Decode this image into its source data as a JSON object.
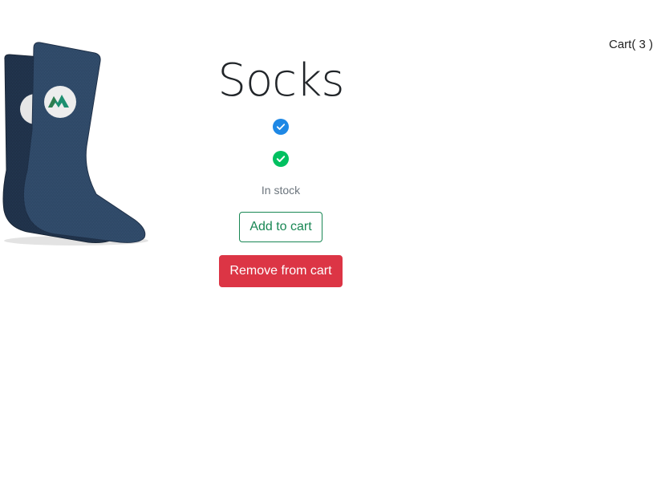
{
  "header": {
    "cart_label": "Cart( 3 )"
  },
  "product": {
    "title": "Socks",
    "image_icon": "socks-product-image",
    "verified_badge_icon": "verified-check-icon",
    "verified_badge_color": "#1e88e5",
    "available_badge_icon": "available-check-icon",
    "available_badge_color": "#00c060",
    "stock_status": "In stock"
  },
  "actions": {
    "add_label": "Add to cart",
    "add_color": "#198754",
    "remove_label": "Remove from cart",
    "remove_color": "#dc3545"
  }
}
